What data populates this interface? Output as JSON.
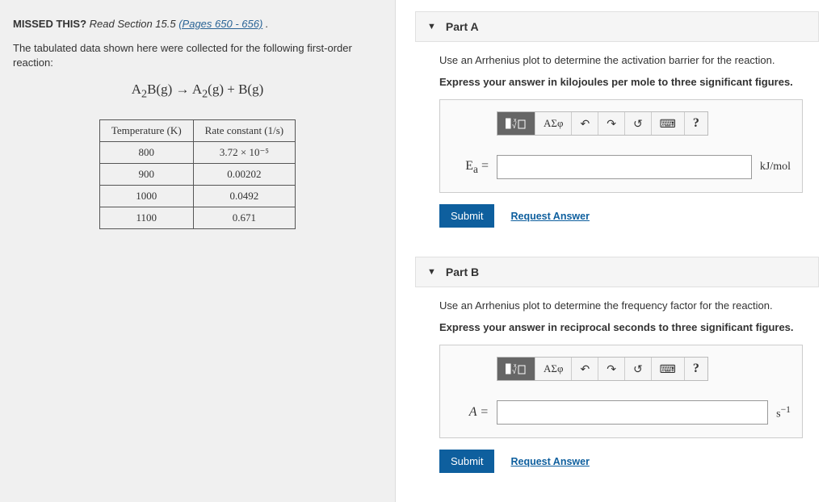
{
  "left": {
    "missed_label": "MISSED THIS?",
    "missed_text": " Read Section 15.5 ",
    "pages_link": "(Pages 650 - 656)",
    "after_link": " .",
    "intro": "The tabulated data shown here were collected for the following first-order reaction:",
    "equation_html": "A<sub>2</sub>B(g) → A<sub>2</sub>(g) + B(g)",
    "table": {
      "header_temp": "Temperature (K)",
      "header_rate": "Rate constant (1/s)",
      "rows": [
        {
          "t": "800",
          "k": "3.72 × 10⁻⁵"
        },
        {
          "t": "900",
          "k": "0.00202"
        },
        {
          "t": "1000",
          "k": "0.0492"
        },
        {
          "t": "1100",
          "k": "0.671"
        }
      ]
    }
  },
  "parts": {
    "a": {
      "title": "Part A",
      "prompt": "Use an Arrhenius plot to determine the activation barrier for the reaction.",
      "instruct": "Express your answer in kilojoules per mole to three significant figures.",
      "var_html": "E<sub>a</sub> =",
      "unit": "kJ/mol"
    },
    "b": {
      "title": "Part B",
      "prompt": "Use an Arrhenius plot to determine the frequency factor for the reaction.",
      "instruct": "Express your answer in reciprocal seconds to three significant figures.",
      "var_html": "A =",
      "unit_html": "s<sup>−1</sup>"
    }
  },
  "toolbar": {
    "greek": "ΑΣφ",
    "undo": "↶",
    "redo": "↷",
    "reset": "↺",
    "help": "?"
  },
  "actions": {
    "submit": "Submit",
    "request": "Request Answer"
  }
}
